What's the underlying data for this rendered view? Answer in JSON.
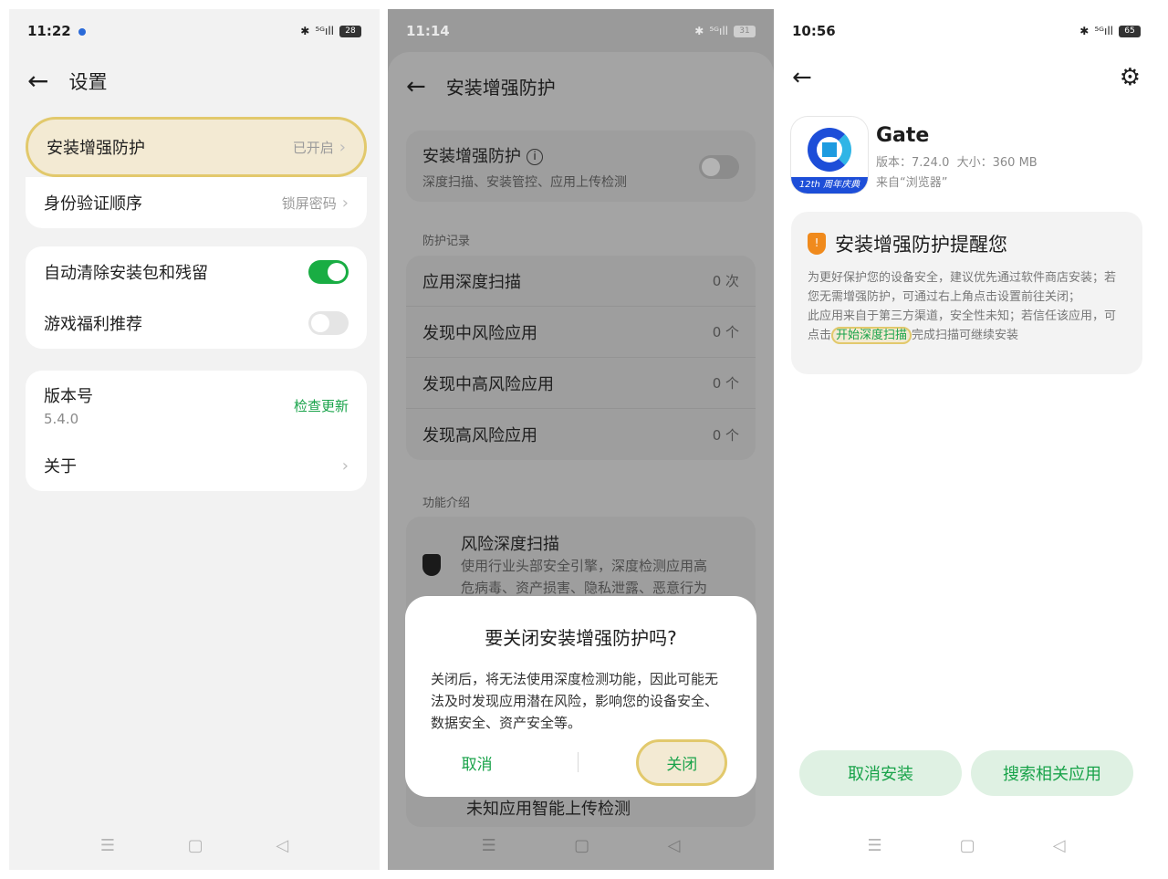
{
  "panel1": {
    "time": "11:22",
    "battery": "28",
    "signal": "⁵ᴳıll",
    "title": "设置",
    "rows": {
      "install_protect": {
        "label": "安装增强防护",
        "value": "已开启"
      },
      "auth_order": {
        "label": "身份验证顺序",
        "value": "锁屏密码"
      },
      "auto_clean": {
        "label": "自动清除安装包和残留",
        "state": "on"
      },
      "game_rec": {
        "label": "游戏福利推荐",
        "state": "off"
      },
      "version": {
        "label": "版本号",
        "value": "5.4.0",
        "action": "检查更新"
      },
      "about": {
        "label": "关于"
      }
    }
  },
  "panel2": {
    "time": "11:14",
    "battery": "31",
    "signal": "⁵ᴳıll",
    "title": "安装增强防护",
    "main_toggle": {
      "label": "安装增强防护",
      "sub": "深度扫描、安装管控、应用上传检测",
      "state": "off"
    },
    "records_header": "防护记录",
    "records": [
      {
        "label": "应用深度扫描",
        "count": "0 次"
      },
      {
        "label": "发现中风险应用",
        "count": "0 个"
      },
      {
        "label": "发现中高风险应用",
        "count": "0 个"
      },
      {
        "label": "发现高风险应用",
        "count": "0 个"
      }
    ],
    "features_header": "功能介绍",
    "feature": {
      "title": "风险深度扫描",
      "desc1": "使用行业头部安全引擎，深度检测应用高",
      "desc2": "危病毒、资产损害、隐私泄露、恶意行为"
    },
    "feature2_title": "未知应用智能上传检测",
    "dialog": {
      "title": "要关闭安装增强防护吗?",
      "body": "关闭后，将无法使用深度检测功能，因此可能无法及时发现应用潜在风险，影响您的设备安全、数据安全、资产安全等。",
      "cancel": "取消",
      "confirm": "关闭"
    }
  },
  "panel3": {
    "time": "10:56",
    "battery": "65",
    "signal": "⁵ᴳıll",
    "app": {
      "name": "Gate",
      "version": "版本：7.24.0",
      "size": "大小：360 MB",
      "source": "来自“浏览器”",
      "badge": "12th 周年庆典"
    },
    "warning": {
      "title": "安装增强防护提醒您",
      "para1": "为更好保护您的设备安全，建议优先通过软件商店安装；若您无需增强防护，可通过右上角点击设置前往关闭；",
      "para2_pre": "此应用来自于第三方渠道，安全性未知；若信任该应用，可点击",
      "para2_link": "开始深度扫描",
      "para2_post": "完成扫描可继续安装"
    },
    "buttons": {
      "cancel": "取消安装",
      "search": "搜索相关应用"
    }
  },
  "nav": {
    "menu": "☰",
    "home": "▢",
    "back": "◁"
  }
}
